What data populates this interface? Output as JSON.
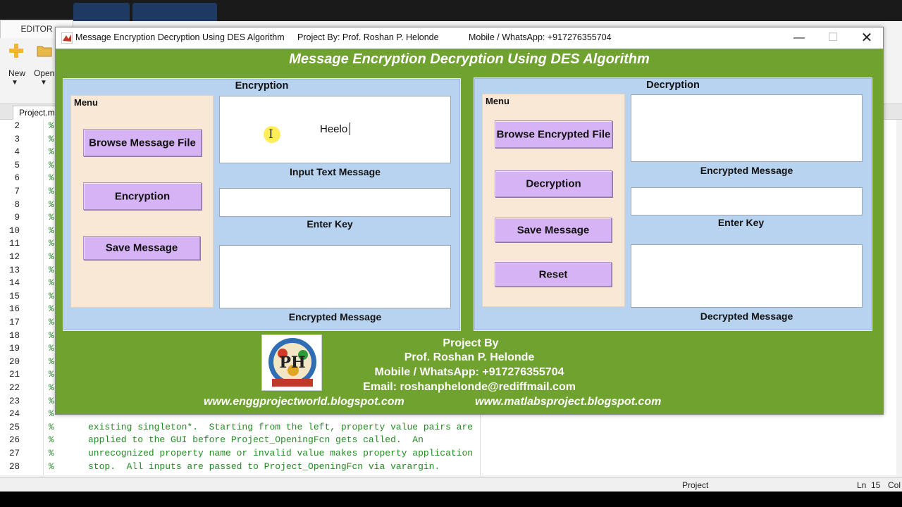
{
  "matlab": {
    "editor_tab": "EDITOR",
    "ribbon": {
      "new_label": "New",
      "open_label": "Open"
    },
    "file_tab": "Project.m",
    "line_numbers": [
      "2",
      "3",
      "4",
      "5",
      "6",
      "7",
      "8",
      "9",
      "10",
      "11",
      "12",
      "13",
      "14",
      "15",
      "16",
      "17",
      "18",
      "19",
      "20",
      "21",
      "22",
      "23",
      "24",
      "25",
      "26",
      "27",
      "28"
    ],
    "comment_marker": "%",
    "code_lines": [
      {
        "ln": "25",
        "text": "existing singleton*.  Starting from the left, property value pairs are"
      },
      {
        "ln": "26",
        "text": "applied to the GUI before Project_OpeningFcn gets called.  An"
      },
      {
        "ln": "27",
        "text": "unrecognized property name or invalid value makes property application"
      },
      {
        "ln": "28",
        "text": "stop.  All inputs are passed to Project_OpeningFcn via varargin."
      }
    ],
    "status": {
      "file": "Project",
      "ln_label": "Ln",
      "ln_value": "15",
      "col_label": "Col"
    }
  },
  "figure": {
    "title_main": "Message Encryption Decryption Using DES Algorithm",
    "title_project": "Project By: Prof. Roshan P. Helonde",
    "title_mobile": "Mobile / WhatsApp: +917276355704",
    "banner": "Message Encryption Decryption Using DES Algorithm",
    "encryption": {
      "title": "Encryption",
      "menu_title": "Menu",
      "buttons": [
        "Browse Message File",
        "Encryption",
        "Save Message"
      ],
      "input_text_value": "Heelo",
      "input_caption": "Input Text Message",
      "key_caption": "Enter Key",
      "encrypted_caption": "Encrypted Message"
    },
    "decryption": {
      "title": "Decryption",
      "menu_title": "Menu",
      "buttons": [
        "Browse Encrypted File",
        "Decryption",
        "Save Message",
        "Reset"
      ],
      "encrypted_caption": "Encrypted Message",
      "key_caption": "Enter Key",
      "decrypted_caption": "Decrypted Message"
    },
    "footer": {
      "line1": "Project By",
      "line2": "Prof. Roshan P. Helonde",
      "line3": "Mobile / WhatsApp: +917276355704",
      "line4": "Email: roshanphelonde@rediffmail.com",
      "url_left": "www.enggprojectworld.blogspot.com",
      "url_right": "www.matlabsproject.blogspot.com"
    }
  },
  "colors": {
    "figure_bg": "#6fa22e",
    "panel_bg": "#b8d3f0",
    "menu_bg": "#fae8d6",
    "button_bg": "#d6b3f4"
  }
}
